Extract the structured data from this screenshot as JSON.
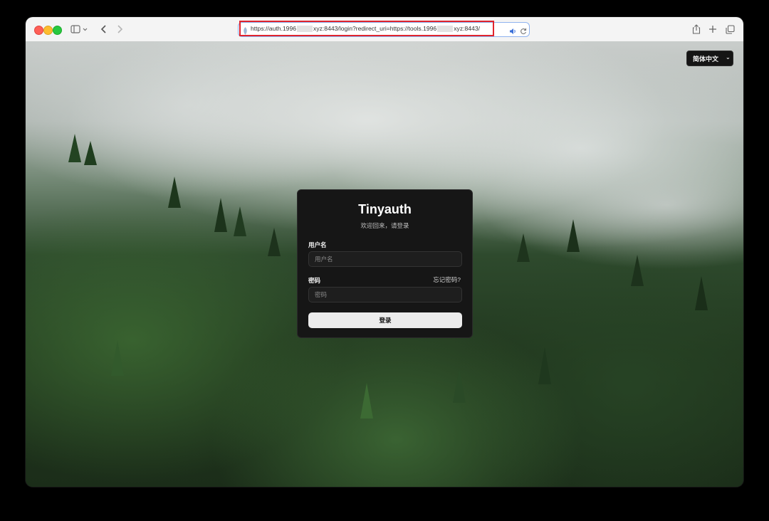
{
  "browser": {
    "url_prefix": "https://auth.1996",
    "url_middle": "xyz:8443/login?redirect_uri=https://tools.1996",
    "url_suffix": "xyz:8443/"
  },
  "language": {
    "label": "简体中文",
    "arrow": "⌄"
  },
  "login": {
    "title": "Tinyauth",
    "subtitle": "欢迎回来，请登录",
    "username_label": "用户名",
    "username_placeholder": "用户名",
    "password_label": "密码",
    "password_placeholder": "密码",
    "forgot_label": "忘记密码?",
    "submit_label": "登录"
  },
  "colors": {
    "card_bg": "#161616",
    "button_bg": "#ececec",
    "highlight": "#e0242d"
  }
}
